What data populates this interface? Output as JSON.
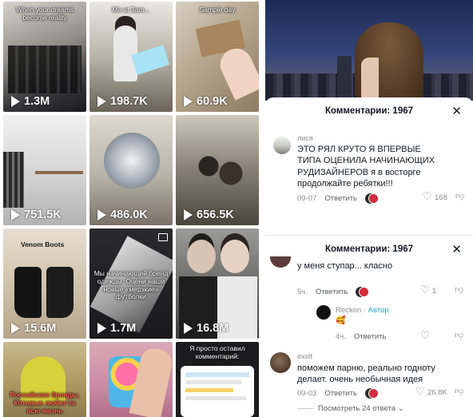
{
  "grid": {
    "tiles": [
      {
        "caption": "When your dreams become reality",
        "views": "1.3M"
      },
      {
        "caption": "Me at 3am...",
        "views": "198.7K"
      },
      {
        "caption": "Sample day",
        "views": "60.9K"
      },
      {
        "caption": "",
        "views": "751.5K"
      },
      {
        "caption": "",
        "views": "486.0K"
      },
      {
        "caption": "",
        "views": "656.5K"
      },
      {
        "caption": "Venom Boots",
        "views": "15.6M"
      },
      {
        "caption": "Мы начинающий бренд одежды. Оцени наши новые «мерзкие» футболки",
        "views": "1.7M"
      },
      {
        "caption": "",
        "views": "16.8M"
      },
      {
        "caption": "Российские бренды, Которые любят за всю жизнь",
        "views": ""
      },
      {
        "caption": "",
        "views": ""
      },
      {
        "caption": "Я просто оставил комментарий:",
        "views": ""
      }
    ]
  },
  "comments_top": {
    "title": "Комментарии: 1967",
    "comment": {
      "username": "лися",
      "text": "ЭТО РЯЛ КРУТО Я ВПЕРВЫЕ ТИПА ОЦЕНИЛА НАЧИНАЮЩИХ РУДИЗАЙНЕРОВ я в восторге продолжайте ребятки!!!",
      "date": "09-07",
      "reply_label": "Ответить",
      "likes": "168"
    }
  },
  "comments_bottom": {
    "title": "Комментарии: 1967",
    "c1": {
      "text": "у меня ступар... класно",
      "date": "5ч.",
      "reply_label": "Ответить",
      "likes": "1"
    },
    "c2": {
      "username": "Reckon",
      "author_tag": "· Автор",
      "text": "🥰",
      "date": "4ч.",
      "reply_label": "Ответить"
    },
    "c3": {
      "username": "exstt",
      "text": "поможем парню, реально годноту делает. очень необычная идея",
      "date": "09-03",
      "reply_label": "Ответить",
      "likes": "26.8K"
    },
    "view_replies": "Посмотреть 24 ответа"
  }
}
